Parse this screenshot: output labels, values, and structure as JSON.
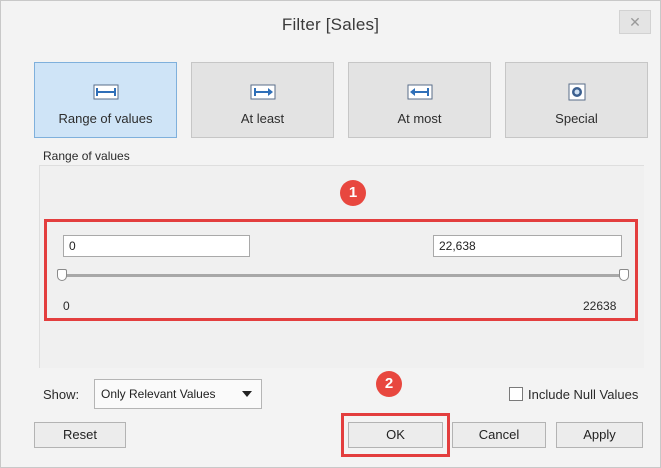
{
  "window": {
    "title": "Filter [Sales]",
    "close_glyph": "✕"
  },
  "modes": [
    {
      "label": "Range of values",
      "icon": "range-icon",
      "active": true
    },
    {
      "label": "At least",
      "icon": "at-least-icon",
      "active": false
    },
    {
      "label": "At most",
      "icon": "at-most-icon",
      "active": false
    },
    {
      "label": "Special",
      "icon": "special-icon",
      "active": false
    }
  ],
  "range": {
    "section_label": "Range of values",
    "min_value": "0",
    "max_value": "22,638",
    "slider_min_label": "0",
    "slider_max_label": "22638"
  },
  "show": {
    "label": "Show:",
    "selected": "Only Relevant Values"
  },
  "include_null": {
    "label": "Include Null Values",
    "checked": false
  },
  "buttons": {
    "reset": "Reset",
    "ok": "OK",
    "cancel": "Cancel",
    "apply": "Apply"
  },
  "annotations": {
    "callout_1": "1",
    "callout_2": "2"
  },
  "colors": {
    "accent_selected": "#cfe4f7",
    "highlight_red": "#e33e3e",
    "callout_red": "#e8473f"
  }
}
